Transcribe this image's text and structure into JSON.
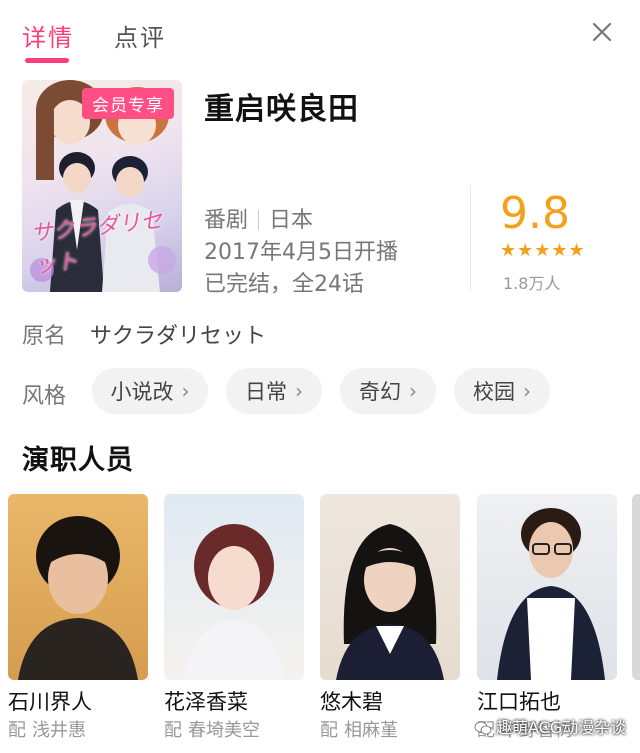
{
  "tabs": {
    "active": "详情",
    "inactive": "点评"
  },
  "poster": {
    "badge": "会员专享",
    "logo_text": "サクラダリセット"
  },
  "show": {
    "title": "重启咲良田",
    "type": "番剧",
    "region": "日本",
    "premiere": "2017年4月5日开播",
    "status": "已完结，全24话",
    "score": "9.8",
    "stars": "★★★★★",
    "raters": "1.8万人",
    "star_color": "#f4a01a"
  },
  "original_name": {
    "label": "原名",
    "value": "サクラダリセット"
  },
  "styles": {
    "label": "风格",
    "tags": [
      "小说改",
      "日常",
      "奇幻",
      "校园"
    ],
    "chevron": "›"
  },
  "cast": {
    "title": "演职人员",
    "role_prefix": "配",
    "members": [
      {
        "name": "石川界人",
        "role": "浅井惠"
      },
      {
        "name": "花泽香菜",
        "role": "春埼美空"
      },
      {
        "name": "悠木碧",
        "role": "相麻堇"
      },
      {
        "name": "江口拓也",
        "role": "中野智树"
      }
    ]
  },
  "watermark": "趣萌ACG动漫杂谈",
  "accent_color": "#ff3d7a"
}
